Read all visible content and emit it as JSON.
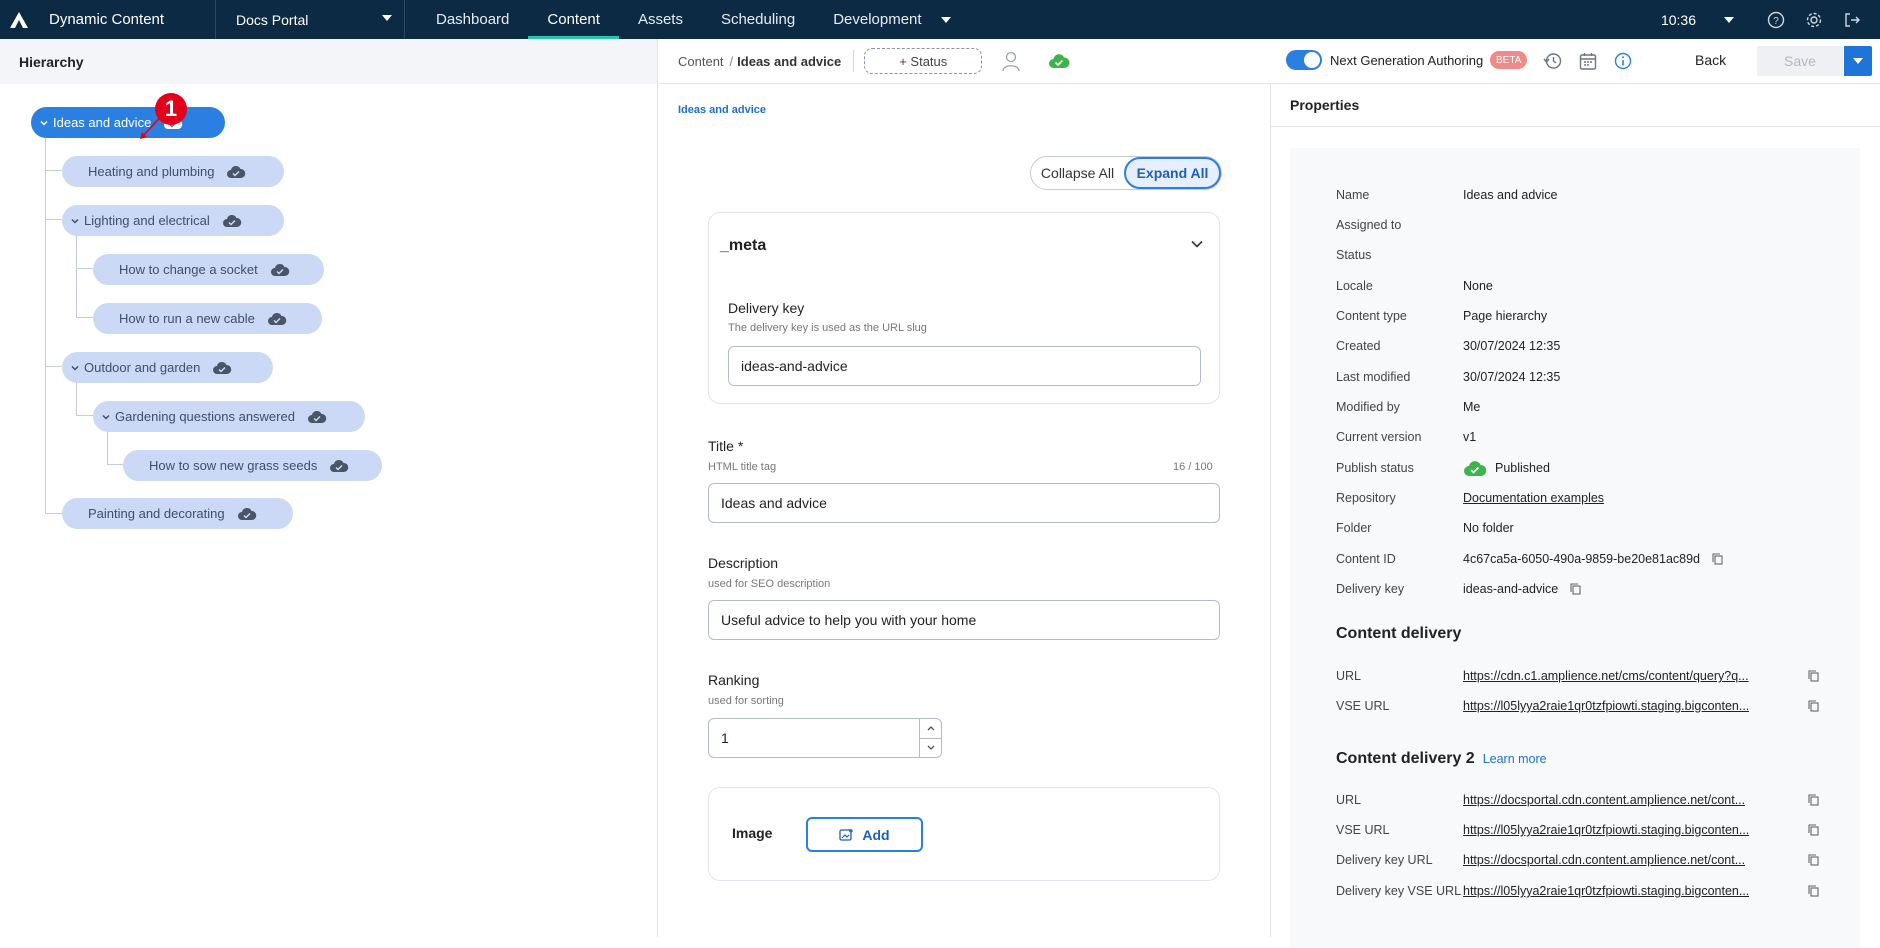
{
  "topbar": {
    "app_name": "Dynamic Content",
    "hub": "Docs Portal",
    "nav": [
      {
        "label": "Dashboard"
      },
      {
        "label": "Content"
      },
      {
        "label": "Assets"
      },
      {
        "label": "Scheduling"
      },
      {
        "label": "Development"
      }
    ],
    "time": "10:36"
  },
  "hierarchy": {
    "title": "Hierarchy",
    "marker": "1",
    "nodes": [
      {
        "label": "Ideas and advice"
      },
      {
        "label": "Heating and plumbing"
      },
      {
        "label": "Lighting and electrical"
      },
      {
        "label": "How to change a socket"
      },
      {
        "label": "How to run a new cable"
      },
      {
        "label": "Outdoor and garden"
      },
      {
        "label": "Gardening questions answered"
      },
      {
        "label": "How to sow new grass seeds"
      },
      {
        "label": "Painting and decorating"
      }
    ]
  },
  "editor_bar": {
    "breadcrumb_root": "Content",
    "breadcrumb_sep": "/",
    "breadcrumb_current": "Ideas and advice",
    "status_button": "+ Status",
    "nga_label": "Next Generation Authoring",
    "beta": "BETA",
    "back": "Back",
    "save": "Save"
  },
  "editor": {
    "crumb": "Ideas and advice",
    "collapse_all": "Collapse All",
    "expand_all": "Expand All",
    "meta": {
      "title": "_meta",
      "delivery_key_label": "Delivery key",
      "delivery_key_help": "The delivery key is used as the URL slug",
      "delivery_key_value": "ideas-and-advice"
    },
    "title_field": {
      "label": "Title *",
      "help": "HTML title tag",
      "count": "16 / 100",
      "value": "Ideas and advice"
    },
    "description_field": {
      "label": "Description",
      "help": "used for SEO description",
      "value": "Useful advice to help you with your home"
    },
    "ranking_field": {
      "label": "Ranking",
      "help": "used for sorting",
      "value": "1"
    },
    "image": {
      "label": "Image",
      "add": "Add"
    }
  },
  "properties": {
    "title": "Properties",
    "rows": [
      {
        "key": "Name",
        "value": "Ideas and advice"
      },
      {
        "key": "Assigned to",
        "value": ""
      },
      {
        "key": "Status",
        "value": ""
      },
      {
        "key": "Locale",
        "value": "None"
      },
      {
        "key": "Content type",
        "value": "Page hierarchy"
      },
      {
        "key": "Created",
        "value": "30/07/2024 12:35"
      },
      {
        "key": "Last modified",
        "value": "30/07/2024 12:35"
      },
      {
        "key": "Modified by",
        "value": "Me"
      },
      {
        "key": "Current version",
        "value": "v1"
      },
      {
        "key": "Publish status",
        "value": "Published"
      },
      {
        "key": "Repository",
        "value": "Documentation examples"
      },
      {
        "key": "Folder",
        "value": "No folder"
      },
      {
        "key": "Content ID",
        "value": "4c67ca5a-6050-490a-9859-be20e81ac89d"
      },
      {
        "key": "Delivery key",
        "value": "ideas-and-advice"
      }
    ],
    "content_delivery": {
      "title": "Content delivery",
      "rows": [
        {
          "key": "URL",
          "value": "https://cdn.c1.amplience.net/cms/content/query?q..."
        },
        {
          "key": "VSE URL",
          "value": "https://l05lyya2raie1qr0tzfpiowti.staging.bigconten..."
        }
      ]
    },
    "content_delivery_2": {
      "title": "Content delivery 2",
      "learn_more": "Learn more",
      "rows": [
        {
          "key": "URL",
          "value": "https://docsportal.cdn.content.amplience.net/cont..."
        },
        {
          "key": "VSE URL",
          "value": "https://l05lyya2raie1qr0tzfpiowti.staging.bigconten..."
        },
        {
          "key": "Delivery key URL",
          "value": "https://docsportal.cdn.content.amplience.net/cont..."
        },
        {
          "key": "Delivery key VSE URL",
          "value": "https://l05lyya2raie1qr0tzfpiowti.staging.bigconten..."
        }
      ]
    }
  },
  "colors": {
    "topbar": "#0d2a45",
    "accent": "#2b7fe0",
    "published": "#3cb44a",
    "marker": "#e3001b"
  }
}
